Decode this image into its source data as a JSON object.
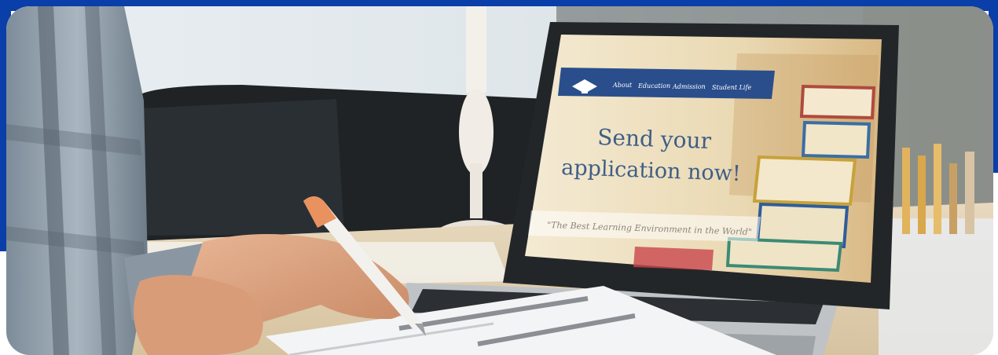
{
  "brand_color": "#0a3ea8",
  "laptop_screen": {
    "nav": {
      "logo_icon": "graduation-cap-icon",
      "items": [
        "About",
        "Education",
        "Admission",
        "Student Life"
      ]
    },
    "headline_line1": "Send your",
    "headline_line2": "application now!",
    "tagline": "\"The Best Learning Environment in the World\""
  }
}
